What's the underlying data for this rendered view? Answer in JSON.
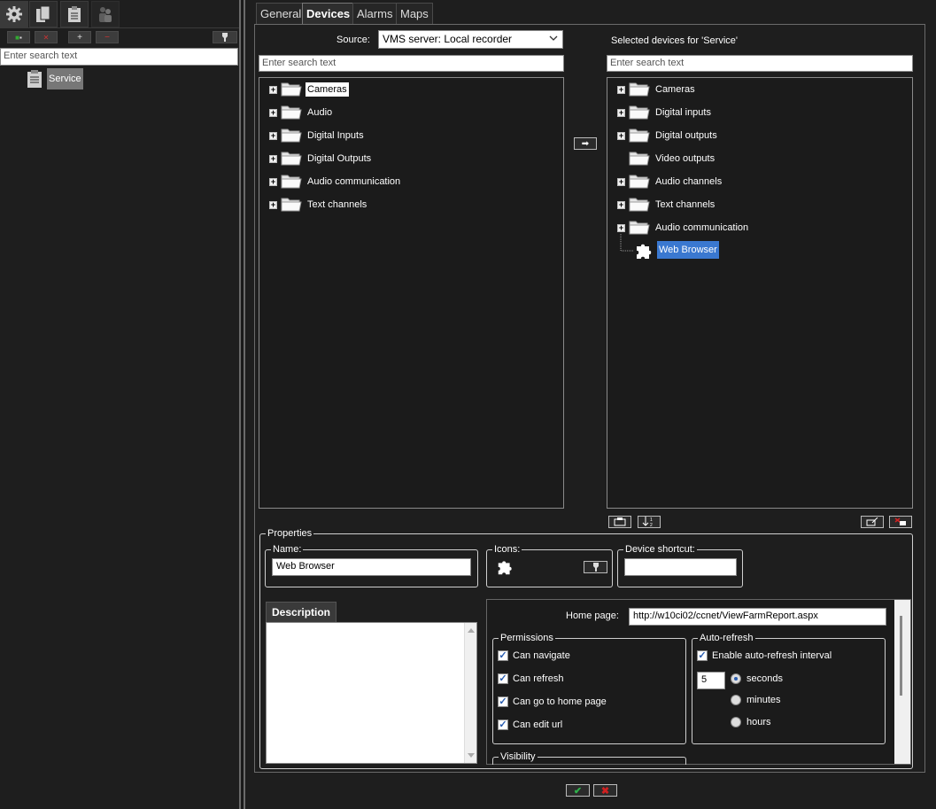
{
  "left": {
    "toolbar_icons": [
      "gear-icon",
      "devices-icon",
      "clipboard-icon",
      "users-icon"
    ],
    "action_buttons": [
      "add-group",
      "remove-group",
      "+",
      "−",
      "pin-icon"
    ],
    "search_placeholder": "Enter search text",
    "tree_item": "Service"
  },
  "tabs": [
    "General",
    "Devices",
    "Alarms",
    "Maps"
  ],
  "source": {
    "label": "Source:",
    "value": "VMS server: Local recorder"
  },
  "selected_title": "Selected devices for 'Service'",
  "search_placeholder_left": "Enter search text",
  "search_placeholder_right": "Enter search text",
  "left_tree": [
    "Cameras",
    "Audio",
    "Digital Inputs",
    "Digital Outputs",
    "Audio communication",
    "Text channels"
  ],
  "right_tree": [
    "Cameras",
    "Digital inputs",
    "Digital outputs",
    "Video outputs",
    "Audio channels",
    "Text channels",
    "Audio communication"
  ],
  "right_tree_child": "Web Browser",
  "add_arrow": "➡",
  "properties": {
    "legend": "Properties",
    "name_legend": "Name:",
    "name_value": "Web Browser",
    "icons_legend": "Icons:",
    "shortcut_legend": "Device shortcut:",
    "description_tab": "Description",
    "home_page_label": "Home page:",
    "home_page_value": "http://w10ci02/ccnet/ViewFarmReport.aspx",
    "permissions_legend": "Permissions",
    "permissions": [
      "Can navigate",
      "Can refresh",
      "Can go to home page",
      "Can edit url"
    ],
    "autorefresh_legend": "Auto-refresh",
    "autorefresh_enable": "Enable auto-refresh interval",
    "interval_value": "5",
    "units": [
      "seconds",
      "minutes",
      "hours"
    ],
    "visibility_legend": "Visibility"
  },
  "footer": {
    "ok": "✔",
    "cancel": "✖"
  },
  "colors": {
    "accent": "#3a78d0",
    "ok": "#2fb04a",
    "cancel": "#d02020"
  }
}
